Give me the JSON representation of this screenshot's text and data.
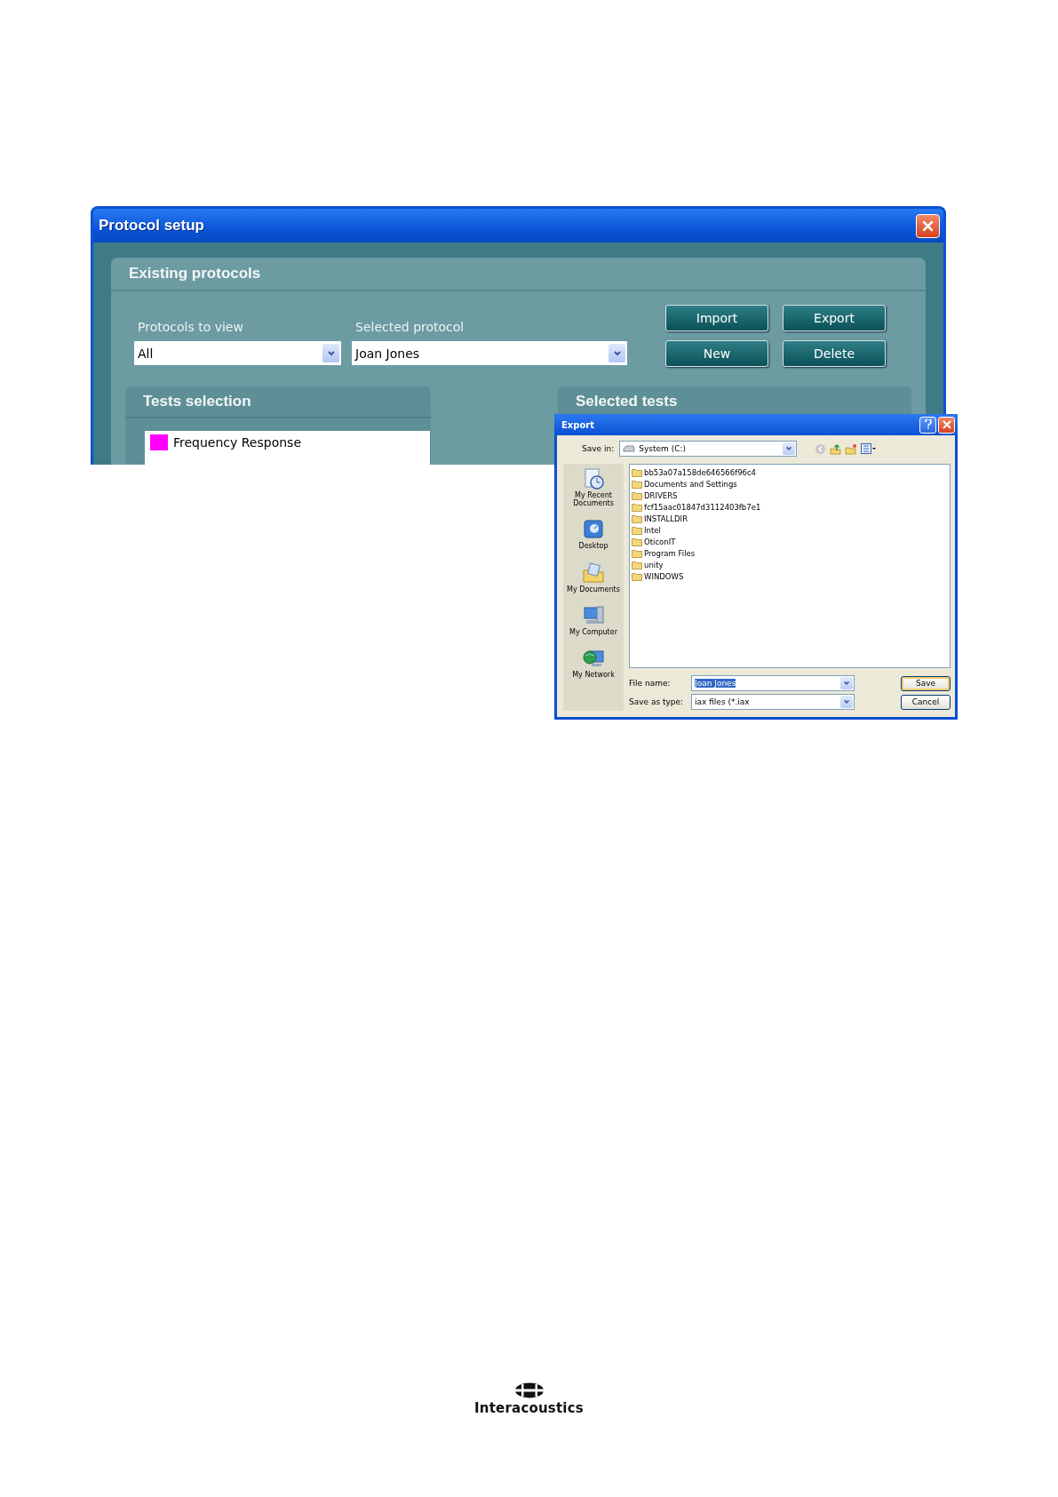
{
  "protocol_window": {
    "title": "Protocol setup",
    "existing_protocols": {
      "title": "Existing protocols",
      "protocols_to_view": {
        "label": "Protocols to view",
        "value": "All"
      },
      "selected_protocol": {
        "label": "Selected protocol",
        "value": "Joan Jones"
      },
      "buttons": [
        "Import",
        "Export",
        "New",
        "Delete"
      ]
    },
    "tests_selection": {
      "title": "Tests selection",
      "items": [
        {
          "label": "Frequency Response",
          "color": "#ff00ff"
        }
      ]
    },
    "selected_tests": {
      "title": "Selected tests"
    }
  },
  "export_dialog": {
    "title": "Export",
    "save_in": {
      "label": "Save in:",
      "value": "System (C:)"
    },
    "places": [
      {
        "kind": "recent",
        "label": "My Recent Documents"
      },
      {
        "kind": "desktop",
        "label": "Desktop"
      },
      {
        "kind": "documents",
        "label": "My Documents"
      },
      {
        "kind": "computer",
        "label": "My Computer"
      },
      {
        "kind": "network",
        "label": "My Network"
      }
    ],
    "files": [
      "bb53a07a158de646566f96c4",
      "Documents and Settings",
      "DRIVERS",
      "fcf15aac01847d3112403fb7e1",
      "INSTALLDIR",
      "Intel",
      "OticonIT",
      "Program Files",
      "unity",
      "WINDOWS"
    ],
    "file_name": {
      "label": "File name:",
      "value": "Joan Jones",
      "selected": true
    },
    "save_as_type": {
      "label": "Save as type:",
      "value": "iax files (*.iax"
    },
    "buttons": [
      "Save",
      "Cancel"
    ]
  },
  "footer": {
    "logo": "Interacoustics"
  }
}
